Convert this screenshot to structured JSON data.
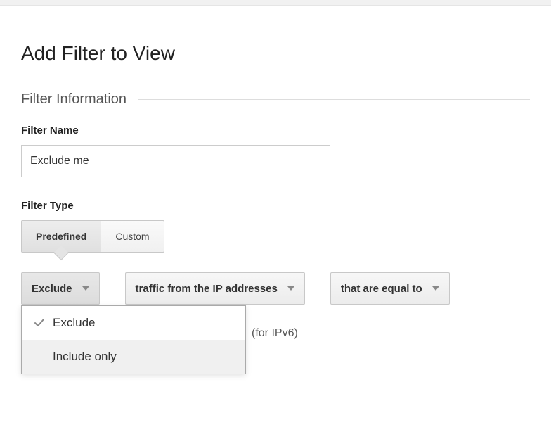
{
  "page_title": "Add Filter to View",
  "section": {
    "title": "Filter Information"
  },
  "filter_name": {
    "label": "Filter Name",
    "value": "Exclude me"
  },
  "filter_type": {
    "label": "Filter Type",
    "options": {
      "predefined": "Predefined",
      "custom": "Custom"
    },
    "selected": "predefined"
  },
  "dropdowns": {
    "action": {
      "value": "Exclude",
      "options": [
        {
          "label": "Exclude",
          "selected": true
        },
        {
          "label": "Include only",
          "selected": false
        }
      ]
    },
    "source": {
      "value": "traffic from the IP addresses"
    },
    "condition": {
      "value": "that are equal to"
    }
  },
  "ip": {
    "hint": "(for IPv6)"
  }
}
